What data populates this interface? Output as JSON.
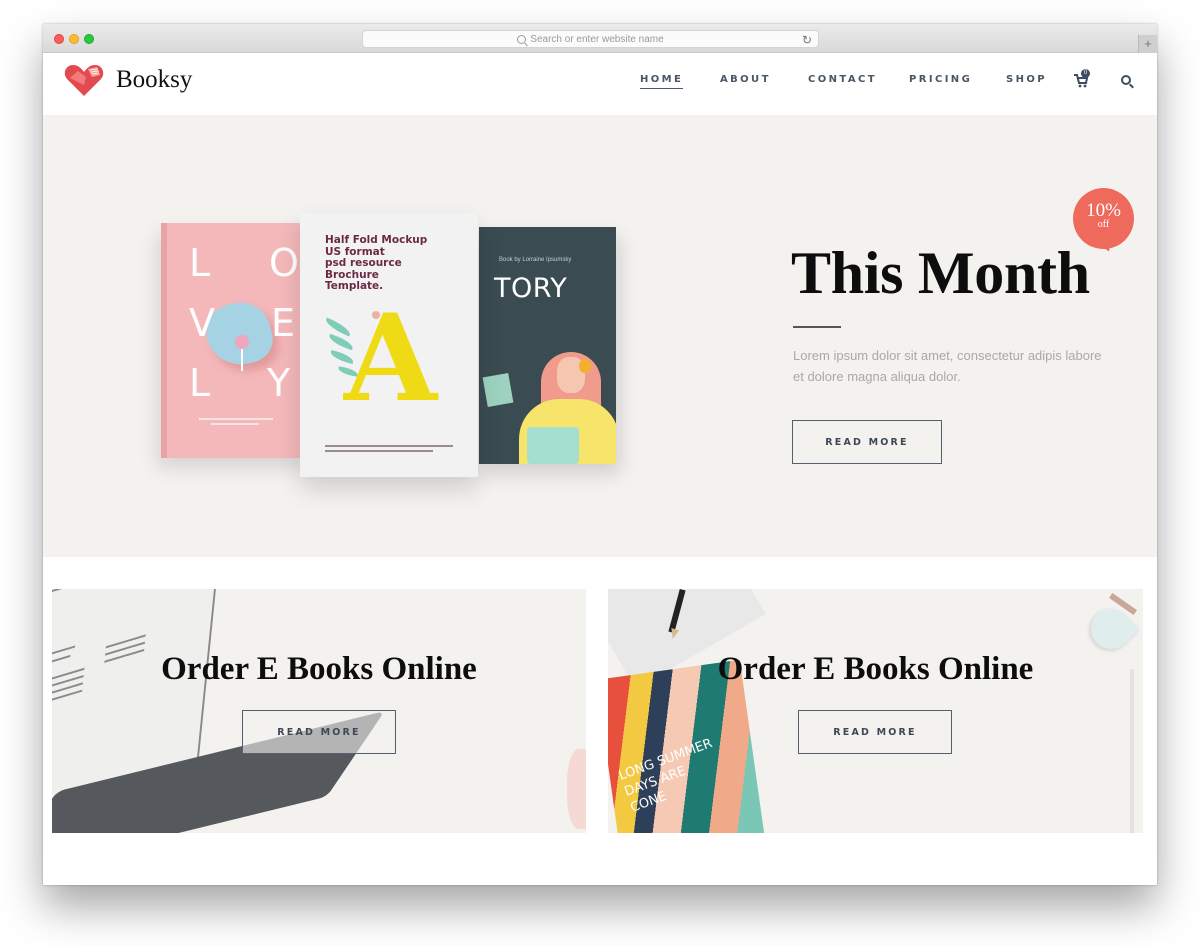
{
  "browser": {
    "url_placeholder": "Search or enter website name",
    "new_tab_label": "+",
    "reload_glyph": "↻"
  },
  "brand": {
    "name": "Booksy",
    "logo_icon": "heart-book-icon",
    "accent_color": "#e34a4f"
  },
  "nav": {
    "items": [
      {
        "label": "HOME",
        "active": true
      },
      {
        "label": "ABOUT",
        "active": false
      },
      {
        "label": "CONTACT",
        "active": false
      },
      {
        "label": "PRICING",
        "active": false
      },
      {
        "label": "SHOP",
        "active": false
      }
    ],
    "cart_icon": "cart-icon",
    "cart_count": "0",
    "search_icon": "search-icon"
  },
  "hero": {
    "badge": {
      "value": "10%",
      "label": "off",
      "color": "#ee6a5c"
    },
    "title": "This Month",
    "text": "Lorem ipsum dolor sit amet, consectetur adipis labore et dolore magna aliqua dolor.",
    "button_label": "READ MORE",
    "books": {
      "lovely": {
        "letters": [
          "L",
          "O",
          "V",
          "E",
          "L",
          "Y"
        ]
      },
      "half_fold": {
        "title": "Half Fold Mockup\nUS format\npsd resource\nBrochure\nTemplate.",
        "letter": "A"
      },
      "tory": {
        "byline": "Book by Lorraine Ipsumsky",
        "title": "TORY"
      }
    }
  },
  "cards": [
    {
      "title": "Order E Books Online",
      "button_label": "READ MORE"
    },
    {
      "title": "Order E Books Online",
      "button_label": "READ MORE",
      "book_text": "LONG SUMMER\nDAYS ARE\nCONE"
    }
  ]
}
